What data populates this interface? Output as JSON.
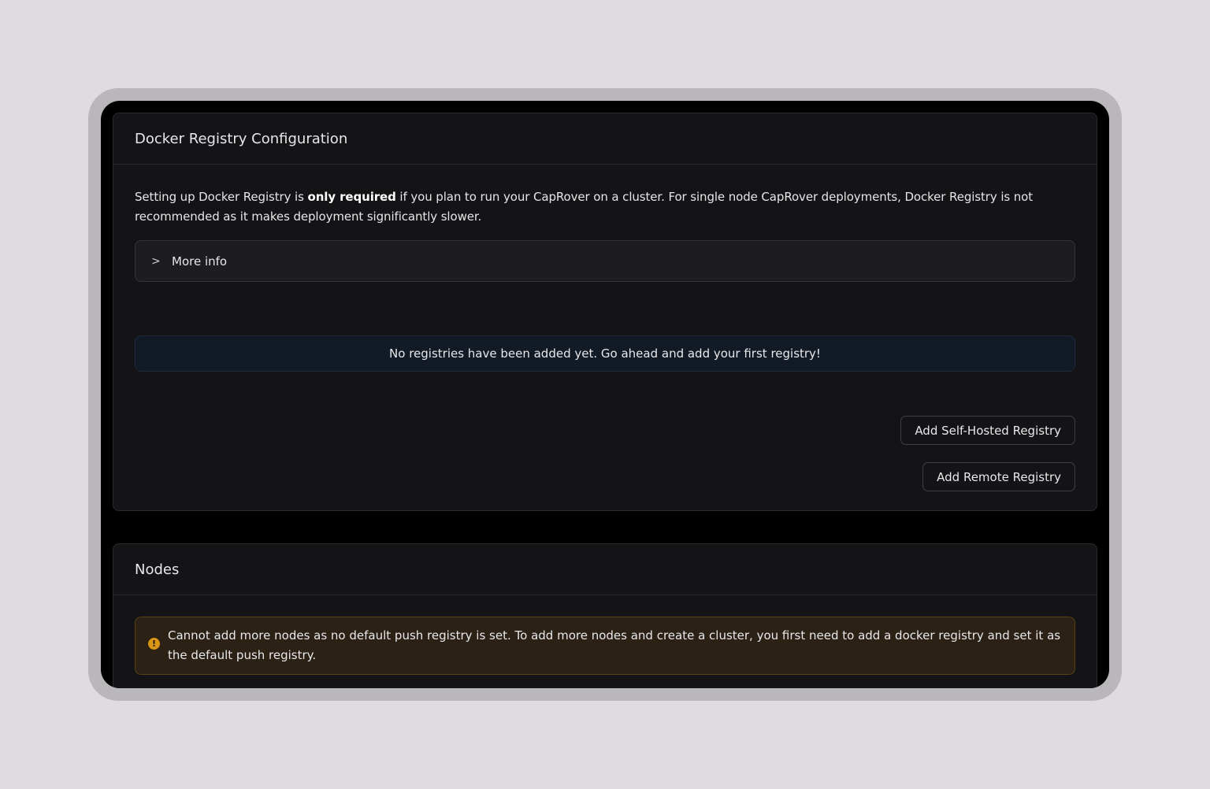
{
  "registry": {
    "title": "Docker Registry Configuration",
    "intro_before": "Setting up Docker Registry is ",
    "intro_bold": "only required",
    "intro_after": " if you plan to run your CapRover on a cluster. For single node CapRover deployments, Docker Registry is not recommended as it makes deployment significantly slower.",
    "more_info_label": "More info",
    "empty_message": "No registries have been added yet. Go ahead and add your first registry!",
    "add_self_hosted_label": "Add Self-Hosted Registry",
    "add_remote_label": "Add Remote Registry"
  },
  "nodes": {
    "title": "Nodes",
    "warning_message": "Cannot add more nodes as no default push registry is set. To add more nodes and create a cluster, you first need to add a docker registry and set it as the default push registry."
  },
  "icons": {
    "chevron": "chevron-right-icon",
    "warning": "exclamation-circle-icon"
  },
  "colors": {
    "warning_accent": "#d89614",
    "background": "#141416"
  }
}
